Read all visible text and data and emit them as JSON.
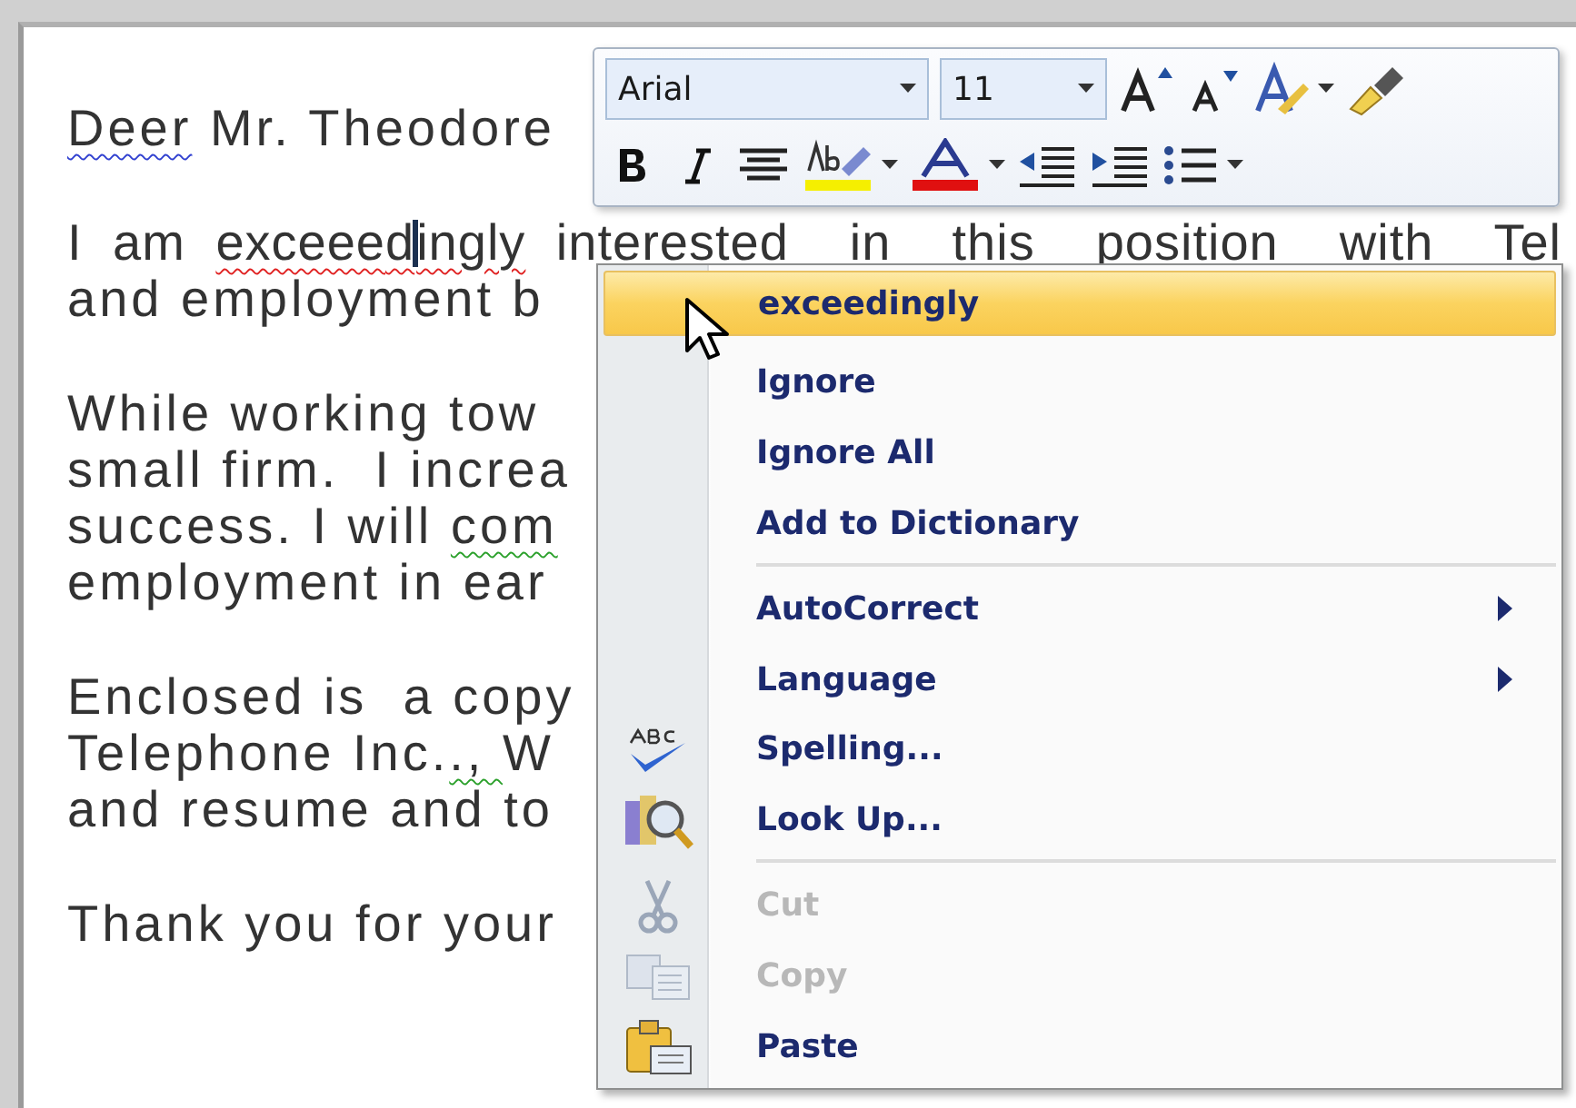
{
  "document": {
    "paragraphs": [
      {
        "lines": [
          [
            {
              "text": "Deer",
              "context_error": true
            },
            {
              "text": " Mr. Theodore"
            }
          ]
        ]
      },
      {
        "lines": [
          [
            {
              "text": "I am "
            },
            {
              "text": "exceee",
              "misspelled": true
            },
            {
              "text": "d",
              "misspelled": true,
              "caret": true
            },
            {
              "text": "ingly",
              "misspelled": true
            },
            {
              "text": " interested  in  this  position  with  Tel"
            }
          ],
          [
            {
              "text": "and employment b"
            }
          ]
        ]
      },
      {
        "lines": [
          [
            {
              "text": "While working tow"
            }
          ],
          [
            {
              "text": "small firm.  I increa"
            }
          ],
          [
            {
              "text": "success. I will "
            },
            {
              "text": "com",
              "grammar_error": true
            }
          ],
          [
            {
              "text": "employment in ear"
            }
          ]
        ]
      },
      {
        "lines": [
          [
            {
              "text": "Enclosed is  a copy"
            }
          ],
          [
            {
              "text": "Telephone Inc."
            },
            {
              "text": "., ",
              "grammar_error": true
            },
            {
              "text": "W"
            }
          ],
          [
            {
              "text": "and resume and to"
            }
          ]
        ]
      },
      {
        "lines": [
          [
            {
              "text": "Thank you for your"
            }
          ]
        ]
      }
    ]
  },
  "mini_toolbar": {
    "font": "Arial",
    "size": "11"
  },
  "context_menu": {
    "groups": [
      [
        {
          "label": "exceedingly",
          "kind": "suggestion",
          "selected": true,
          "disabled": false,
          "submenu": false
        },
        {
          "label": "Ignore",
          "kind": "command",
          "selected": false,
          "disabled": false,
          "submenu": false
        },
        {
          "label": "Ignore All",
          "kind": "command",
          "selected": false,
          "disabled": false,
          "submenu": false
        },
        {
          "label": "Add to Dictionary",
          "kind": "command",
          "selected": false,
          "disabled": false,
          "submenu": false
        }
      ],
      [
        {
          "label": "AutoCorrect",
          "kind": "command",
          "selected": false,
          "disabled": false,
          "submenu": true
        },
        {
          "label": "Language",
          "kind": "command",
          "selected": false,
          "disabled": false,
          "submenu": true
        },
        {
          "label": "Spelling...",
          "kind": "command",
          "selected": false,
          "disabled": false,
          "submenu": false
        },
        {
          "label": "Look Up...",
          "kind": "command",
          "selected": false,
          "disabled": false,
          "submenu": false
        }
      ],
      [
        {
          "label": "Cut",
          "kind": "command",
          "selected": false,
          "disabled": true,
          "submenu": false
        },
        {
          "label": "Copy",
          "kind": "command",
          "selected": false,
          "disabled": true,
          "submenu": false
        },
        {
          "label": "Paste",
          "kind": "command",
          "selected": false,
          "disabled": false,
          "submenu": false
        }
      ]
    ]
  }
}
